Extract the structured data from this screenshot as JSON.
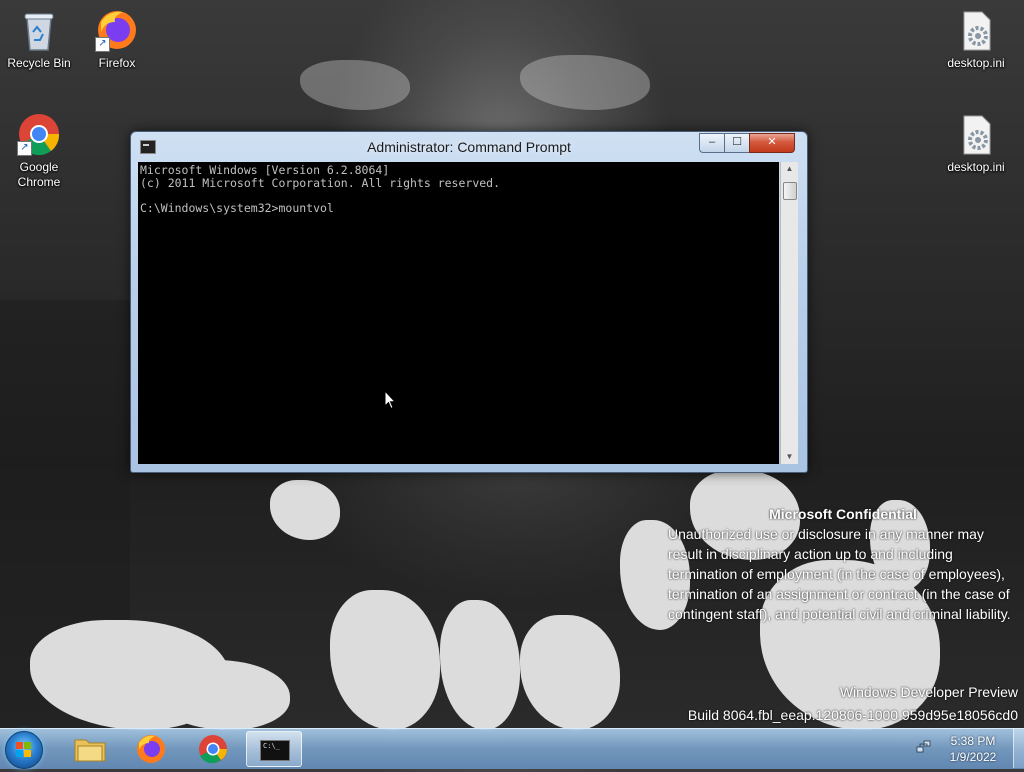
{
  "desktop": {
    "icons": [
      {
        "label": "Recycle Bin"
      },
      {
        "label": "Firefox"
      },
      {
        "label": "Google Chrome"
      },
      {
        "label": "desktop.ini"
      },
      {
        "label": "desktop.ini"
      }
    ]
  },
  "cmd_window": {
    "title": "Administrator: Command Prompt",
    "minimize_label": "–",
    "maximize_label": "☐",
    "close_label": "✕",
    "lines": [
      "Microsoft Windows [Version 6.2.8064]",
      "(c) 2011 Microsoft Corporation. All rights reserved.",
      "",
      "C:\\Windows\\system32>mountvol"
    ]
  },
  "watermark": {
    "title": "Microsoft Confidential",
    "body": "Unauthorized use or disclosure in any manner may result in disciplinary action up to and including termination of employment (in the case of employees), termination of an assignment or contract (in the case of contingent staff), and potential civil and criminal liability.",
    "product": "Windows Developer Preview",
    "build": "Build 8064.fbl_eeap.120806-1000.959d95e18056cd0"
  },
  "taskbar": {
    "items": [
      {
        "icon": "file-explorer-icon"
      },
      {
        "icon": "firefox-icon"
      },
      {
        "icon": "chrome-icon"
      },
      {
        "icon": "command-prompt-icon",
        "active": true
      }
    ],
    "cmd_thumb_text": "C:\\_",
    "clock_time": "5:38 PM",
    "clock_date": "1/9/2022"
  },
  "colors": {
    "console_bg": "#000000",
    "console_text": "#c0c0c0",
    "close_button": "#c33a1c",
    "taskbar": "#78a0c8"
  }
}
